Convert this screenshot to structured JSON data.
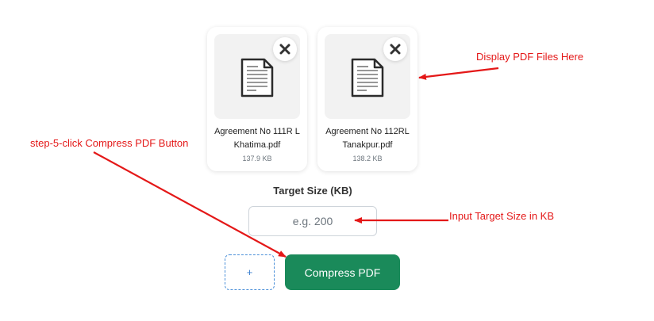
{
  "files": [
    {
      "name_line1": "Agreement No 111R L",
      "name_line2": "Khatima.pdf",
      "size": "137.9 KB"
    },
    {
      "name_line1": "Agreement No 112RL",
      "name_line2": "Tanakpur.pdf",
      "size": "138.2 KB"
    }
  ],
  "target": {
    "label": "Target Size (KB)",
    "placeholder": "e.g. 200",
    "value": ""
  },
  "actions": {
    "add_label": "+",
    "compress_label": "Compress PDF"
  },
  "annotations": {
    "display_files": "Display PDF Files Here",
    "step5": "step-5-click Compress PDF Button",
    "input_target": "Input Target Size in KB"
  },
  "colors": {
    "accent": "#1a8a5a",
    "annotation": "#e41818",
    "dashed_border": "#4a8fd8"
  },
  "icons": {
    "file": "document-icon",
    "remove": "close-icon"
  }
}
